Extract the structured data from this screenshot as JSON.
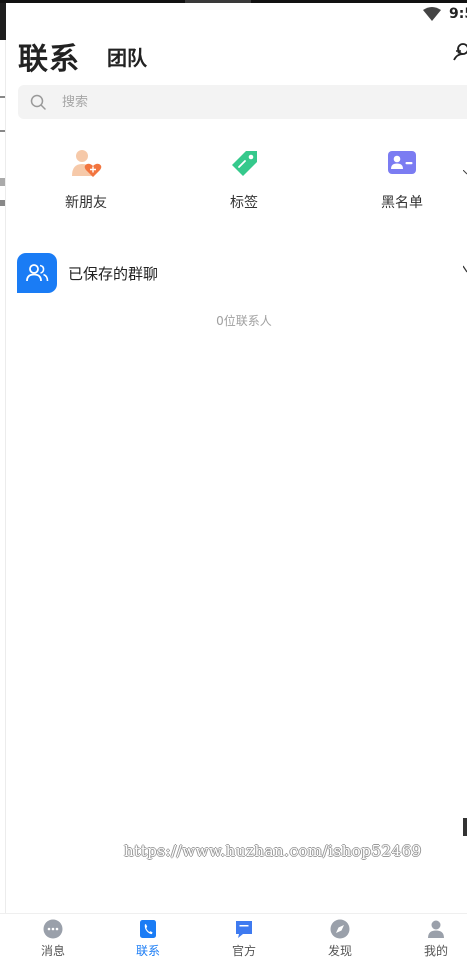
{
  "status_bar": {
    "time": "9:5"
  },
  "header": {
    "tab_contacts": "联系",
    "tab_team": "团队"
  },
  "search": {
    "placeholder": "搜索"
  },
  "quick_entries": [
    {
      "label": "新朋友",
      "icon": "new-friend-icon",
      "color": "#f2753f"
    },
    {
      "label": "标签",
      "icon": "tag-icon",
      "color": "#35c98c"
    },
    {
      "label": "黑名单",
      "icon": "blacklist-icon",
      "color": "#7b7cf2"
    }
  ],
  "saved_groups": {
    "label": "已保存的群聊",
    "icon": "group-icon"
  },
  "contact_count": "0位联系人",
  "watermark": "https://www.huzhan.com/ishop52469",
  "bottom_nav": [
    {
      "label": "消息",
      "icon": "message-icon"
    },
    {
      "label": "联系",
      "icon": "contacts-icon",
      "active": true
    },
    {
      "label": "官方",
      "icon": "official-icon"
    },
    {
      "label": "发现",
      "icon": "discover-icon"
    },
    {
      "label": "我的",
      "icon": "profile-icon"
    }
  ],
  "colors": {
    "accent": "#1a7cf5",
    "inactive_icon": "#9aa0aa"
  }
}
